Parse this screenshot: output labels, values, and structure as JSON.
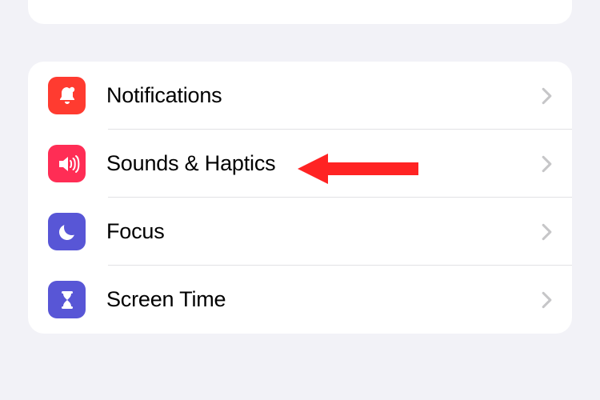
{
  "settings": {
    "items": [
      {
        "label": "Notifications",
        "icon": "bell-badge-icon",
        "color": "#ff3b30"
      },
      {
        "label": "Sounds & Haptics",
        "icon": "speaker-wave-icon",
        "color": "#ff2d55"
      },
      {
        "label": "Focus",
        "icon": "moon-icon",
        "color": "#5856d6"
      },
      {
        "label": "Screen Time",
        "icon": "hourglass-icon",
        "color": "#5856d6"
      }
    ]
  },
  "annotation": {
    "color": "#ff2323",
    "target": "sounds-haptics"
  }
}
